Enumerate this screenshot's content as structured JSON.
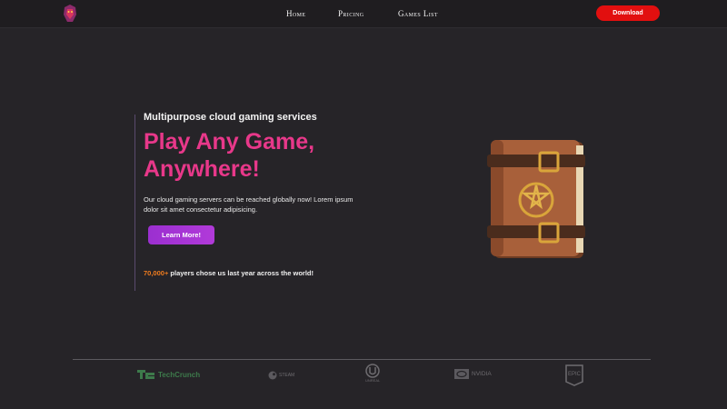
{
  "nav": {
    "home": "Home",
    "pricing": "Pricing",
    "games_list": "Games List",
    "download": "Download"
  },
  "hero": {
    "subtitle": "Multipurpose cloud gaming services",
    "title_line1": "Play Any Game,",
    "title_line2": "Anywhere!",
    "description": "Our cloud gaming servers can be reached globally now! Lorem ipsum dolor sit amet consectetur adipisicing.",
    "cta": "Learn More!",
    "stats_number": "70,000+",
    "stats_text": " players chose us last year across the world!"
  },
  "partners": {
    "techcrunch": "TechCrunch",
    "steam": "STEAM",
    "unreal": "UNREAL",
    "nvidia": "NVIDIA",
    "epic": "EPIC"
  },
  "colors": {
    "accent_pink": "#e8388a",
    "accent_purple": "#9b2fd0",
    "download_red": "#e20f0f",
    "stats_orange": "#f07c1f"
  }
}
